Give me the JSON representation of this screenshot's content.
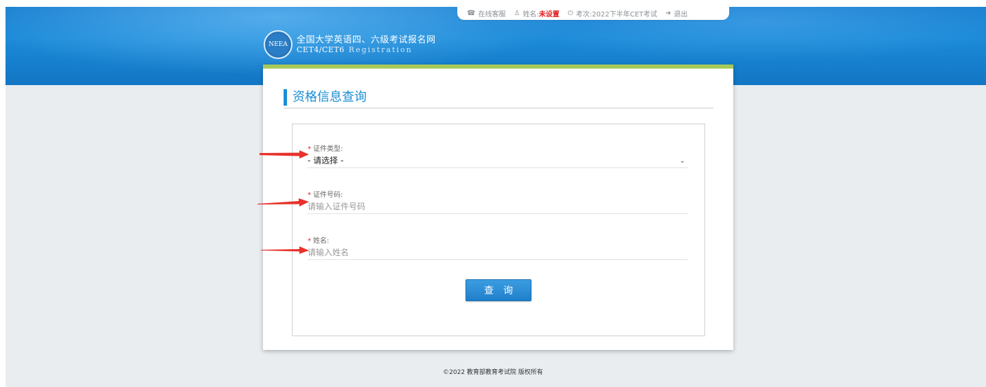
{
  "topbar": {
    "service_label": "在线客服",
    "name_label": "姓名:",
    "name_value": "未设置",
    "exam_label": "考次:",
    "exam_value": "2022下半年CET考试",
    "logout_label": "退出"
  },
  "brand": {
    "logo_text": "NEEA",
    "title": "全国大学英语四、六级考试报名网",
    "subtitle": "CET4/CET6",
    "subtitle_en": "Registration"
  },
  "card": {
    "title": "资格信息查询"
  },
  "form": {
    "id_type": {
      "label": "证件类型:",
      "value": "- 请选择 -"
    },
    "id_number": {
      "label": "证件号码:",
      "placeholder": "请输入证件号码"
    },
    "name": {
      "label": "姓名:",
      "placeholder": "请输入姓名"
    },
    "required_mark": "*",
    "submit_label": "查询"
  },
  "footer": {
    "copyright": "©2022  教育部教育考试院  版权所有"
  },
  "colors": {
    "header_blue": "#1a7fd0",
    "accent_green": "#a6c95a",
    "title_blue": "#1a8fd6",
    "required_red": "#e21b1b",
    "annotation_arrow": "#e8322b"
  },
  "icons": {
    "service": "headset-icon",
    "user": "user-icon",
    "exam": "power-icon",
    "logout": "logout-icon",
    "select": "chevron-down-icon"
  }
}
